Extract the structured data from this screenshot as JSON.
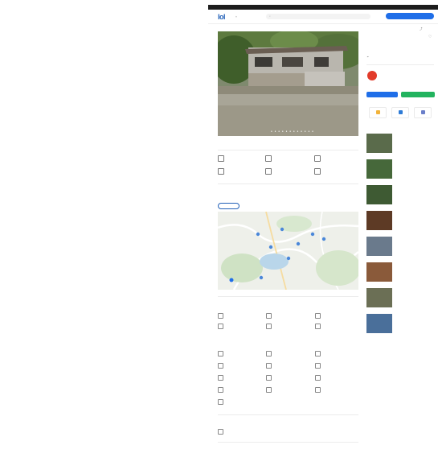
{
  "topbar": {
    "left_tabs": [
      "",
      "",
      ""
    ],
    "right_links": [
      "",
      ""
    ]
  },
  "header": {
    "logo": "lol",
    "location": "",
    "search_placeholder": "",
    "account": "",
    "cta": ""
  },
  "breadcrumb": "",
  "share_label": "",
  "listing": {
    "title": "",
    "price": "",
    "meta_link": ""
  },
  "specs": [
    {
      "label": "",
      "value": ""
    },
    {
      "label": "",
      "value": ""
    },
    {
      "label": "",
      "value": ""
    },
    {
      "label": "",
      "value": ""
    },
    {
      "label": "",
      "value": ""
    },
    {
      "label": "",
      "value": ""
    }
  ],
  "nearby": {
    "title": "",
    "subtitle": "",
    "tabs": [
      "",
      "",
      "",
      "",
      "",
      ""
    ],
    "active_tab": 0
  },
  "property_features": {
    "title": "",
    "items": [
      "",
      "",
      "",
      "",
      "",
      ""
    ]
  },
  "amenities": {
    "title": "",
    "items": [
      "",
      "",
      "",
      "",
      "",
      "",
      "",
      "",
      "",
      "",
      "",
      "",
      ""
    ]
  },
  "documents": {
    "title": "",
    "item": ""
  },
  "description": {
    "title": "",
    "lines": [
      "",
      ""
    ],
    "footer_note": ""
  },
  "agent": {
    "initials": "",
    "name": "",
    "sub": ""
  },
  "actions": {
    "call": "",
    "message": ""
  },
  "quick_actions": [
    "",
    "",
    ""
  ],
  "similar": {
    "title": "",
    "items": [
      {
        "title": "",
        "price": "",
        "thumb_color": "#5a6b4b"
      },
      {
        "title": "",
        "price": "",
        "thumb_color": "#46683a"
      },
      {
        "title": "",
        "price": "",
        "thumb_color": "#3e5a33"
      },
      {
        "title": "",
        "price": "",
        "thumb_color": "#5d3a25"
      },
      {
        "title": "",
        "price": "",
        "thumb_color": "#6a7a8c"
      },
      {
        "title": "",
        "price": "",
        "thumb_color": "#8a5a3a"
      },
      {
        "title": "",
        "price": "",
        "thumb_color": "#6b6f55"
      },
      {
        "title": "",
        "price": "",
        "thumb_color": "#4a6f9a"
      }
    ]
  },
  "colors": {
    "primary": "#1f6ee8",
    "accent_green": "#22b35e",
    "agent_red": "#e23b2a",
    "topbar": "#1d1d1d"
  },
  "icons": {
    "logo": "lol-logo",
    "location": "pin-icon",
    "search": "search-icon",
    "share": "share-icon",
    "favorite": "heart-icon"
  }
}
